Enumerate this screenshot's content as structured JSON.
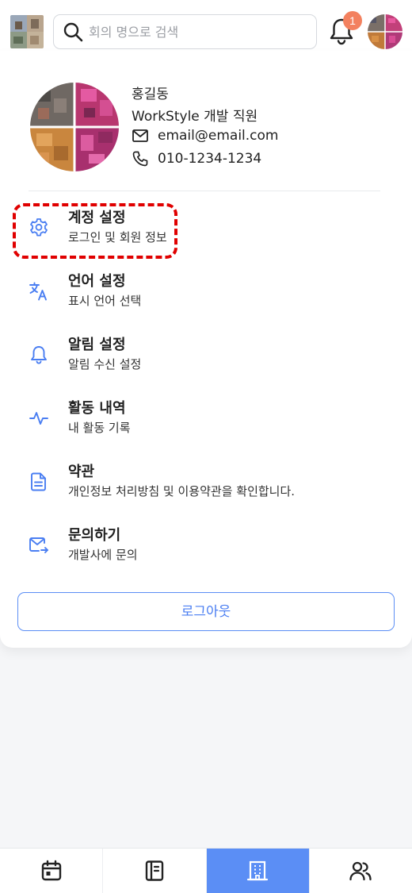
{
  "search": {
    "placeholder": "회의 명으로 검색"
  },
  "notifications": {
    "count": "1"
  },
  "profile": {
    "name": "홍길동",
    "role": "WorkStyle 개발 직원",
    "email": "email@email.com",
    "phone": "010-1234-1234"
  },
  "menu": [
    {
      "title": "계정 설정",
      "subtitle": "로그인 및 회원 정보",
      "icon": "gear-icon"
    },
    {
      "title": "언어 설정",
      "subtitle": "표시 언어 선택",
      "icon": "translate-icon"
    },
    {
      "title": "알림 설정",
      "subtitle": "알림 수신 설정",
      "icon": "bell-icon"
    },
    {
      "title": "활동 내역",
      "subtitle": "내 활동 기록",
      "icon": "activity-icon"
    },
    {
      "title": "약관",
      "subtitle": "개인정보 처리방침 및 이용약관을 확인합니다.",
      "icon": "document-icon"
    },
    {
      "title": "문의하기",
      "subtitle": "개발사에 문의",
      "icon": "mail-send-icon"
    }
  ],
  "logout_label": "로그아웃",
  "bottom_nav": [
    {
      "icon": "calendar-icon"
    },
    {
      "icon": "notebook-icon"
    },
    {
      "icon": "building-icon",
      "active": true
    },
    {
      "icon": "people-icon"
    }
  ],
  "colors": {
    "accent": "#5b8ef5",
    "badge": "#f3815f",
    "highlight": "#e00000",
    "icon_blue": "#4a7ef2"
  }
}
